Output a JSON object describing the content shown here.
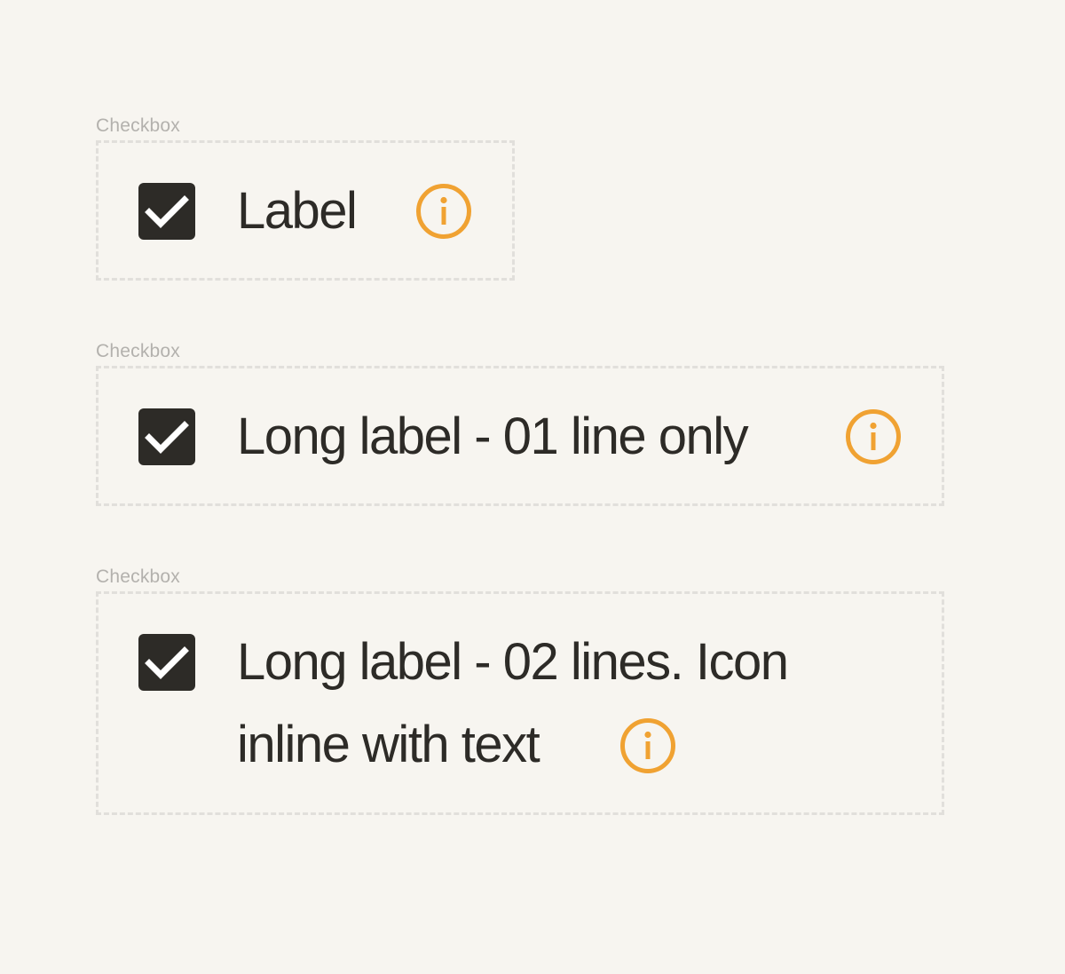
{
  "colors": {
    "background": "#f7f5f0",
    "caption": "#b3b1ad",
    "frame_border": "#e1dfdb",
    "checkbox_fill": "#2d2b27",
    "checkmark": "#ffffff",
    "label_text": "#2d2b27",
    "info_icon": "#f0a232"
  },
  "examples": [
    {
      "caption": "Checkbox",
      "checked": true,
      "checkbox_icon": "checkmark-icon",
      "label": "Label",
      "info_icon": "info-circle-icon"
    },
    {
      "caption": "Checkbox",
      "checked": true,
      "checkbox_icon": "checkmark-icon",
      "label": "Long label - 01 line only",
      "info_icon": "info-circle-icon"
    },
    {
      "caption": "Checkbox",
      "checked": true,
      "checkbox_icon": "checkmark-icon",
      "label_lines": [
        "Long label - 02 lines. Icon",
        "inline with text"
      ],
      "info_icon": "info-circle-icon"
    }
  ]
}
